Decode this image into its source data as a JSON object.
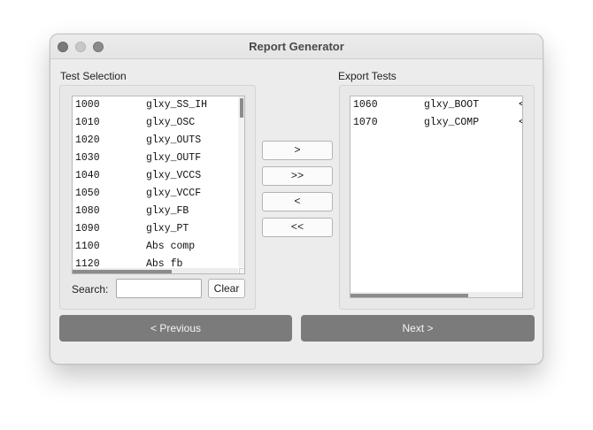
{
  "window": {
    "title": "Report Generator"
  },
  "test_selection": {
    "label": "Test Selection",
    "items": [
      {
        "code": "1000",
        "name": "glxy_SS_IH"
      },
      {
        "code": "1010",
        "name": "glxy_OSC"
      },
      {
        "code": "1020",
        "name": "glxy_OUTS"
      },
      {
        "code": "1030",
        "name": "glxy_OUTF"
      },
      {
        "code": "1040",
        "name": "glxy_VCCS"
      },
      {
        "code": "1050",
        "name": "glxy_VCCF"
      },
      {
        "code": "1080",
        "name": "glxy_FB"
      },
      {
        "code": "1090",
        "name": "glxy_PT"
      },
      {
        "code": "1100",
        "name": "Abs comp"
      },
      {
        "code": "1120",
        "name": "Abs fb"
      }
    ],
    "search_label": "Search:",
    "search_value": "",
    "clear_label": "Clear"
  },
  "transfer_buttons": {
    "add": ">",
    "add_all": ">>",
    "remove": "<",
    "remove_all": "<<"
  },
  "export_tests": {
    "label": "Export Tests",
    "items": [
      {
        "code": "1060",
        "name": "glxy_BOOT",
        "trail": "<"
      },
      {
        "code": "1070",
        "name": "glxy_COMP",
        "trail": "<"
      }
    ]
  },
  "nav": {
    "previous": "< Previous",
    "next": "Next >"
  }
}
